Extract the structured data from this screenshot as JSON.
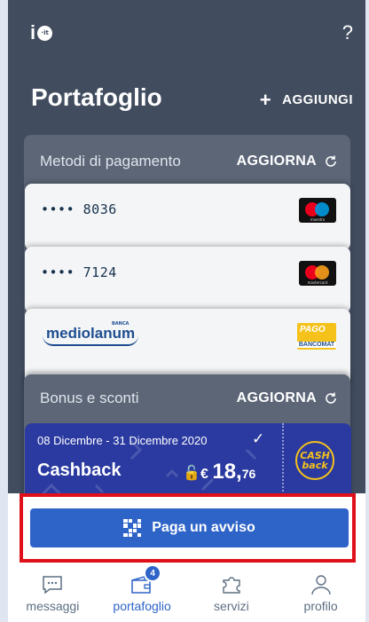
{
  "header": {
    "logo_text": "i",
    "logo_badge": "·it",
    "help_label": "?",
    "title": "Portafoglio",
    "add_label": "AGGIUNGI",
    "add_icon": "+"
  },
  "payment_methods": {
    "title": "Metodi di pagamento",
    "refresh_label": "AGGIORNA",
    "cards": [
      {
        "number": "•••• 8036",
        "brand": "maestro",
        "brand_label": "maestro"
      },
      {
        "number": "•••• 7124",
        "brand": "mastercard",
        "brand_label": "mastercard"
      }
    ],
    "bank": {
      "name": "mediolanum",
      "name_small": "BANCA",
      "circuit_top": "PAGO",
      "circuit_bottom": "BANCOMAT"
    }
  },
  "bonus": {
    "title": "Bonus e sconti",
    "refresh_label": "AGGIORNA",
    "cashback": {
      "dates": "08 Dicembre - 31 Dicembre 2020",
      "name": "Cashback",
      "currency": "€",
      "amount_int": "18,",
      "amount_dec": "76",
      "logo_text": "CASH back"
    }
  },
  "pay_button": {
    "label": "Paga un avviso"
  },
  "tabs": [
    {
      "label": "messaggi",
      "icon": "message-icon",
      "active": false
    },
    {
      "label": "portafoglio",
      "icon": "wallet-icon",
      "active": true,
      "badge": "4"
    },
    {
      "label": "servizi",
      "icon": "puzzle-icon",
      "active": false
    },
    {
      "label": "profilo",
      "icon": "profile-icon",
      "active": false
    }
  ],
  "colors": {
    "background": "#414c5f",
    "accent": "#2e64c8",
    "cashback": "#2a3aa0",
    "highlight": "#e0101a"
  }
}
